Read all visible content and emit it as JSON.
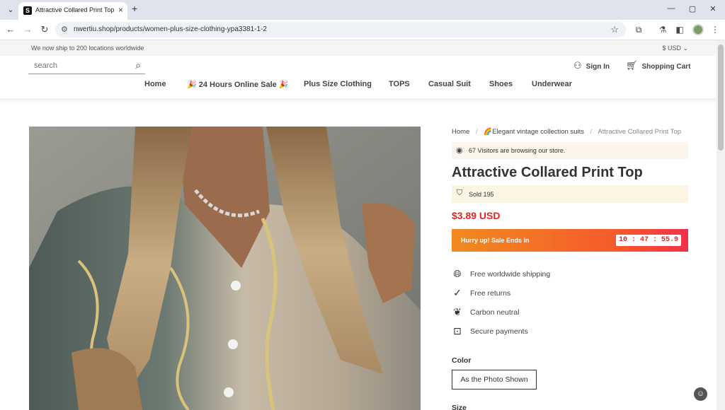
{
  "browser": {
    "tab_title": "Attractive Collared Print Top",
    "tab_favicon_letter": "S",
    "url": "nwertiu.shop/products/women-plus-size-clothing-ypa3381-1-2"
  },
  "topbar": {
    "announcement": "We now ship to 200 locations worldwide",
    "currency": "$ USD"
  },
  "header": {
    "search_placeholder": "search",
    "sign_in": "Sign In",
    "cart": "Shopping Cart"
  },
  "nav": {
    "items": [
      {
        "label": "Home"
      },
      {
        "label": "🎉 24 Hours Online Sale 🎉"
      },
      {
        "label": "Plus Size Clothing"
      },
      {
        "label": "TOPS"
      },
      {
        "label": "Casual Suit"
      },
      {
        "label": "Shoes"
      },
      {
        "label": "Underwear"
      }
    ]
  },
  "breadcrumb": {
    "home": "Home",
    "sep": "/",
    "collection": "🌈Elegant vintage collection suits",
    "current": "Attractive Collared Print Top"
  },
  "product": {
    "visitors_text": "67 Visitors are browsing our store.",
    "title": "Attractive Collared Print Top",
    "sold_text": "Sold 195",
    "price": "$3.89 USD",
    "sale_text": "Hurry up! Sale Ends in",
    "countdown": "10 : 47 : 55.9",
    "features": [
      {
        "label": "Free worldwide shipping",
        "icon": "globe-icon"
      },
      {
        "label": "Free returns",
        "icon": "check-circle-icon"
      },
      {
        "label": "Carbon neutral",
        "icon": "leaf-icon"
      },
      {
        "label": "Secure payments",
        "icon": "lock-icon"
      }
    ],
    "color_label": "Color",
    "color_option": "As the Photo Shown",
    "size_label": "Size"
  },
  "colors": {
    "price_red": "#e8231f",
    "sale_gradient_start": "#f28a1e",
    "sale_gradient_end": "#f2304a"
  }
}
